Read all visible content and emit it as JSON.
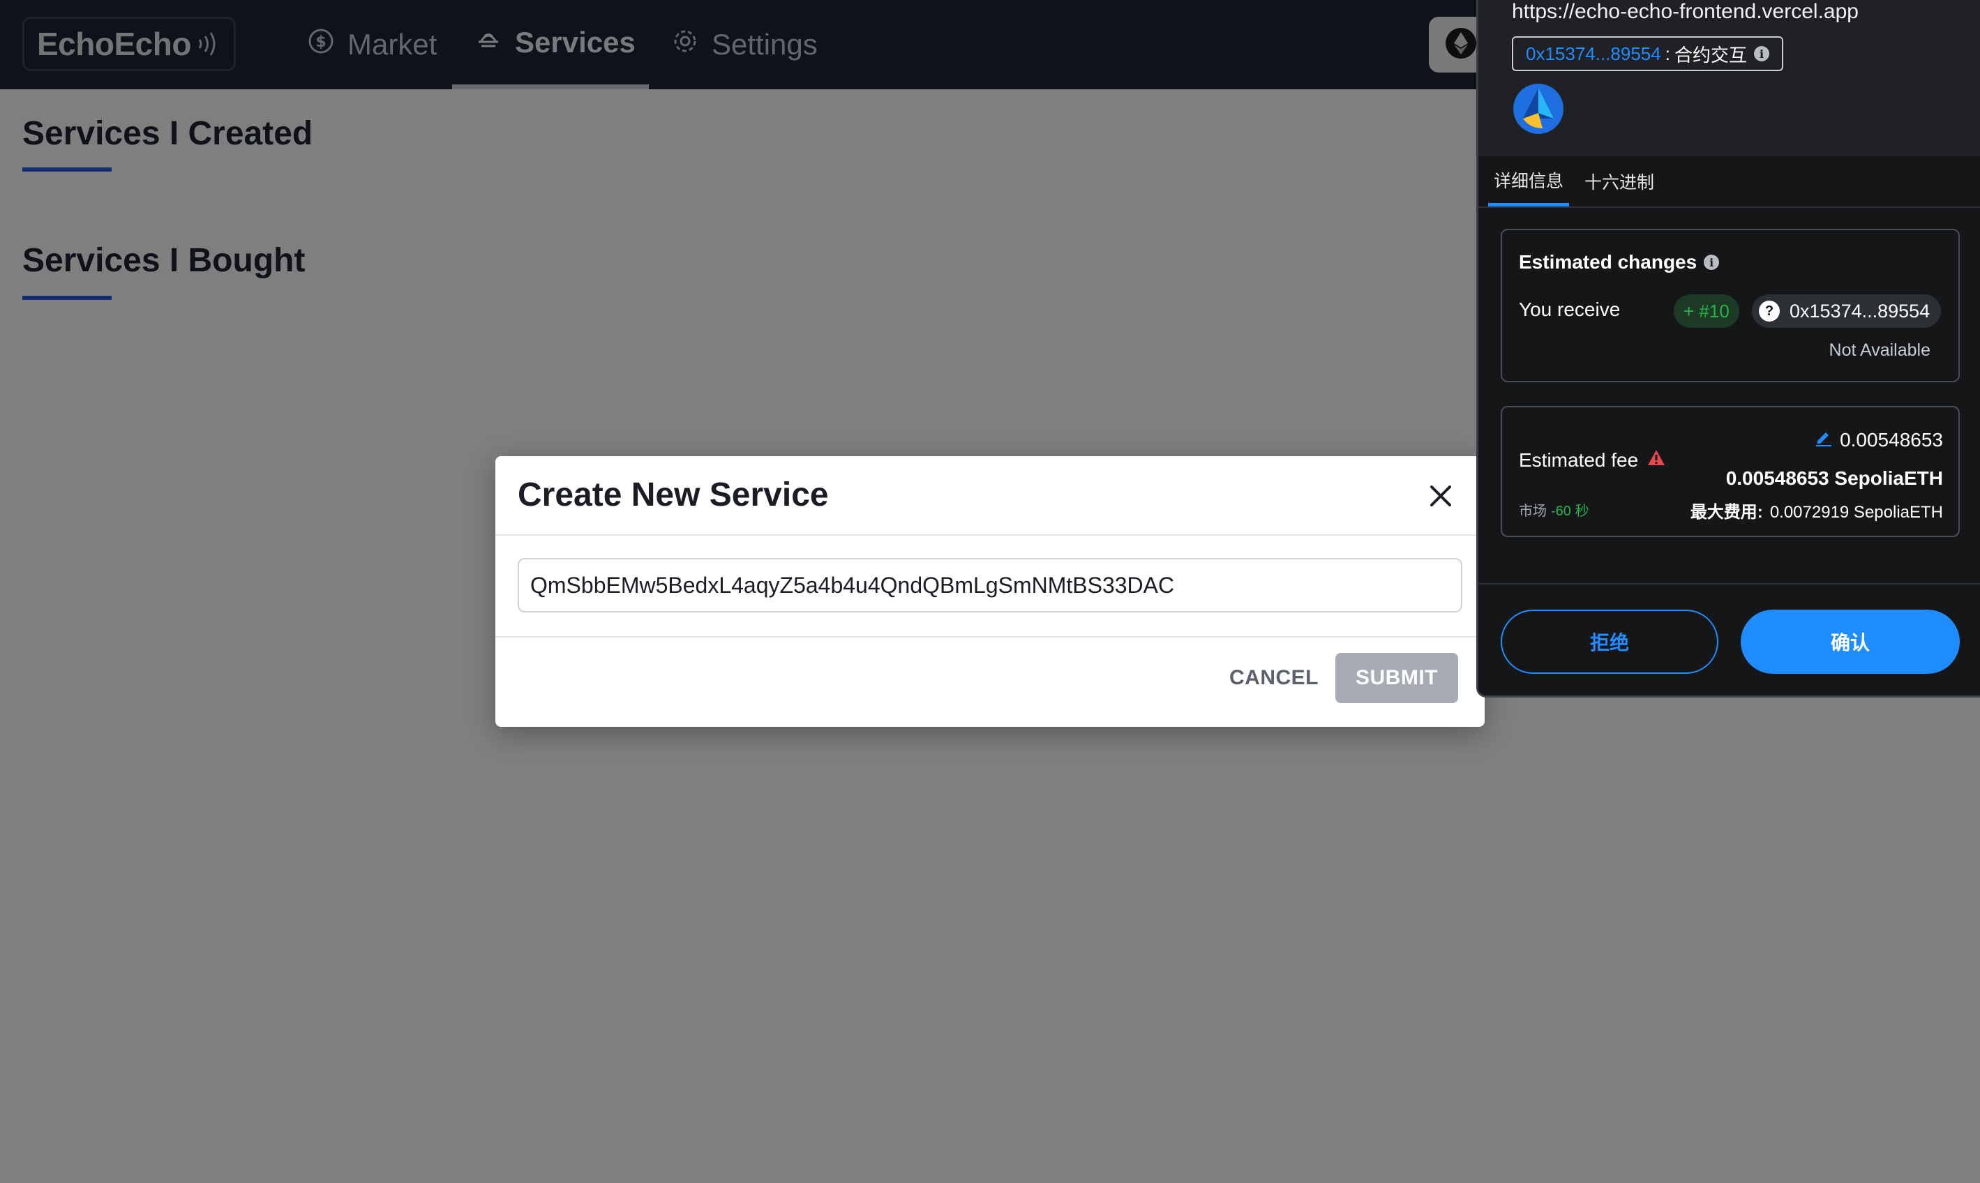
{
  "app": {
    "logo_text": "EchoEcho",
    "nav": {
      "market": "Market",
      "services": "Services",
      "settings": "Settings"
    },
    "sections": {
      "created": "Services I Created",
      "bought": "Services I Bought"
    },
    "colors": {
      "navbar": "#1c2536",
      "accent_underline": "#2f5bd9"
    }
  },
  "modal": {
    "title": "Create New Service",
    "input_value": "QmSbbEMw5BedxL4aqyZ5a4b4u4QndQBmLgSmNMtBS33DAC",
    "cancel_label": "CANCEL",
    "submit_label": "SUBMIT",
    "icons": {
      "close": "close-icon"
    }
  },
  "wallet": {
    "site_url": "https://echo-echo-frontend.vercel.app",
    "contract_address": "0x15374...89554",
    "contract_sep": ":",
    "contract_label": "合约交互",
    "tabs": {
      "details": "详细信息",
      "hex": "十六进制"
    },
    "changes": {
      "title": "Estimated changes",
      "you_receive": "You receive",
      "nft_amount": "+ #10",
      "receive_address": "0x15374...89554",
      "not_available": "Not Available"
    },
    "fee": {
      "label": "Estimated fee",
      "edit_value": "0.00548653",
      "main_value": "0.00548653 SepoliaETH",
      "market_label": "市场",
      "market_time": "-60 秒",
      "max_label": "最大费用:",
      "max_value": "0.0072919 SepoliaETH"
    },
    "buttons": {
      "reject": "拒绝",
      "confirm": "确认"
    },
    "colors": {
      "primary": "#1f8cff",
      "positive": "#29b34a",
      "warning": "#e5484d"
    }
  }
}
